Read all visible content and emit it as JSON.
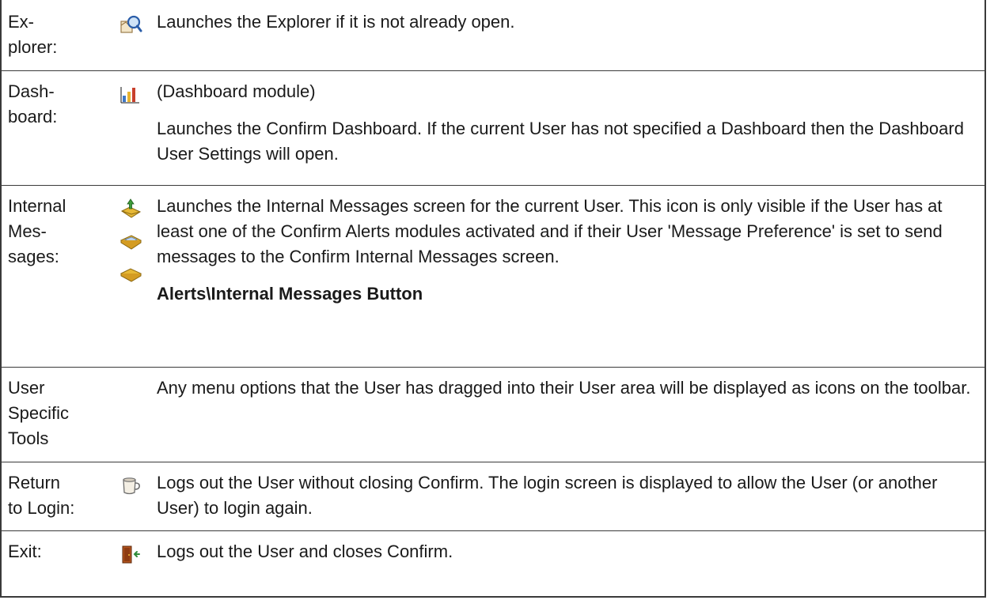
{
  "rows": [
    {
      "label": "Ex-\nplorer:",
      "icons": [
        "explorer-icon"
      ],
      "paragraphs": [
        "Launches the Explorer if it is not already open."
      ]
    },
    {
      "label": "Dash-\nboard:",
      "icons": [
        "dashboard-icon"
      ],
      "paragraphs": [
        "(Dashboard module)",
        "Launches the Confirm Dashboard. If the current User has not specified a Dashboard then the Dashboard User Settings will open."
      ]
    },
    {
      "label": "Internal\nMes-\nsages:",
      "icons": [
        "message-new-icon",
        "message-open-icon",
        "message-closed-icon"
      ],
      "paragraphs": [
        "Launches the Internal Messages screen for the current User. This icon is only visible if the User has at least one of the Confirm Alerts modules activated and if their User 'Message Preference' is set to send messages to the Confirm Internal Messages screen.",
        "Alerts\\Internal Messages Button"
      ]
    },
    {
      "label": "User\nSpecific\nTools",
      "icons": [],
      "paragraphs": [
        "Any menu options that the User has dragged into their User area will be displayed as icons on the toolbar."
      ]
    },
    {
      "label": "Return\nto Login:",
      "icons": [
        "return-to-login-icon"
      ],
      "paragraphs": [
        "Logs out the User without closing Confirm. The login screen is displayed to allow the User (or another User) to login again."
      ]
    },
    {
      "label": "Exit:",
      "icons": [
        "exit-door-icon"
      ],
      "paragraphs": [
        "Logs out the User and closes Confirm."
      ]
    }
  ]
}
